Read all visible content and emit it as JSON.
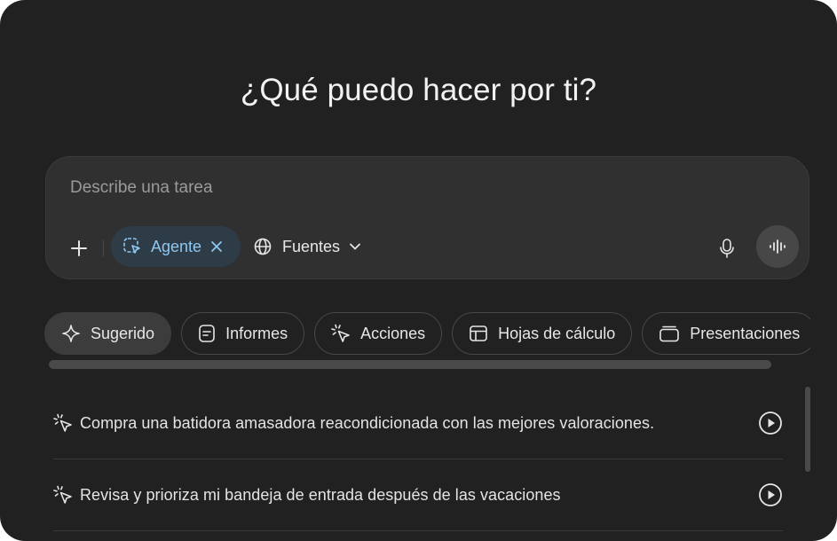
{
  "headline": "¿Qué puedo hacer por ti?",
  "composer": {
    "placeholder": "Describe una tarea",
    "agent_label": "Agente",
    "sources_label": "Fuentes",
    "agent_color": "#8ec7ef",
    "agent_bg": "#2e3c48"
  },
  "tabs": [
    {
      "label": "Sugerido",
      "icon": "sparkle-icon",
      "active": true
    },
    {
      "label": "Informes",
      "icon": "document-icon",
      "active": false
    },
    {
      "label": "Acciones",
      "icon": "cursor-click-icon",
      "active": false
    },
    {
      "label": "Hojas de cálculo",
      "icon": "table-icon",
      "active": false
    },
    {
      "label": "Presentaciones",
      "icon": "slides-icon",
      "active": false
    }
  ],
  "suggestions": [
    {
      "text": "Compra una batidora amasadora reacondicionada con las mejores valoraciones.",
      "icon": "cursor-click-icon"
    },
    {
      "text": "Revisa y prioriza mi bandeja de entrada después de las vacaciones",
      "icon": "cursor-click-icon"
    }
  ],
  "colors": {
    "background": "#212121",
    "composer": "#303030",
    "text": "#ececec"
  }
}
